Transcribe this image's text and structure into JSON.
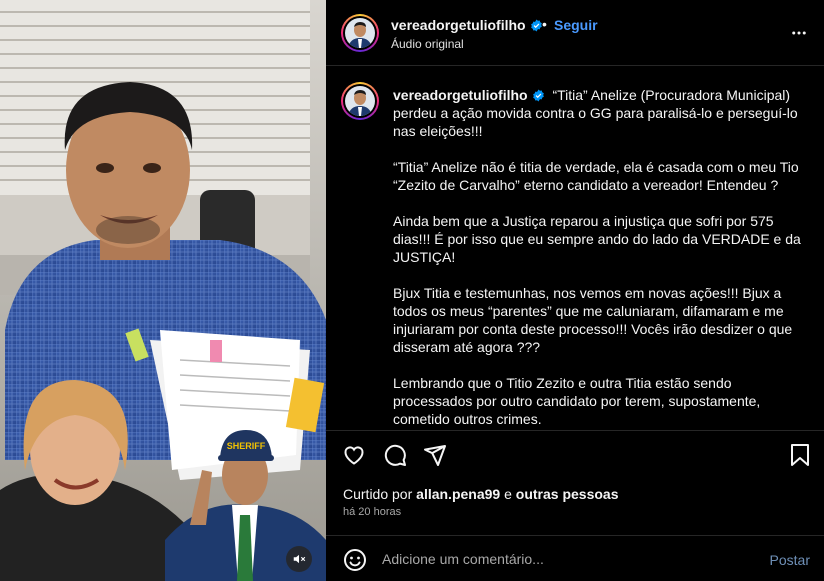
{
  "post": {
    "username": "vereadorgetuliofilho",
    "follow_label": "Seguir",
    "separator": "•",
    "audio_label": "Áudio original",
    "caption": {
      "username": "vereadorgetuliofilho",
      "first_line": "“Titia” Anelize (Procuradora Municipal) perdeu a ação movida contra o GG para paralisá-lo e perseguí-lo nas eleições!!!",
      "paragraphs": [
        "“Titia” Anelize não é titia de verdade, ela é casada com o meu Tio “Zezito de Carvalho” eterno candidato a vereador! Entendeu ?",
        "Ainda bem que a Justiça reparou a injustiça que sofri por 575 dias!!! É por isso que eu sempre ando do lado da VERDADE e da JUSTIÇA!",
        "Bjux Titia e testemunhas, nos vemos em novas ações!!! Bjux a todos os meus “parentes” que me caluniaram, difamaram e me injuriaram por conta deste processo!!! Vocês irão desdizer o que disseram até agora ???",
        "Lembrando que o Titio Zezito e outra Titia estão sendo processados por outro candidato por terem, supostamente, cometido outros crimes."
      ]
    },
    "likes": {
      "prefix": "Curtido por",
      "user": "allan.pena99",
      "connector": "e",
      "others": "outras pessoas"
    },
    "time_ago": "há 20 horas",
    "comment": {
      "placeholder": "Adicione um comentário...",
      "post_label": "Postar"
    },
    "media": {
      "badge_text": "SHERIFF"
    },
    "icons": {
      "more": "more-horizontal-icon",
      "like": "heart-icon",
      "comment": "comment-icon",
      "share": "send-icon",
      "save": "bookmark-icon",
      "emoji": "emoji-icon",
      "mute": "speaker-muted-icon",
      "verified": "verified-badge-icon"
    },
    "colors": {
      "background": "#000000",
      "text": "#f5f5f5",
      "secondary_text": "#a8a8a8",
      "link_blue": "#4a9aff",
      "verified_blue": "#0095f6",
      "divider": "#262626"
    }
  }
}
